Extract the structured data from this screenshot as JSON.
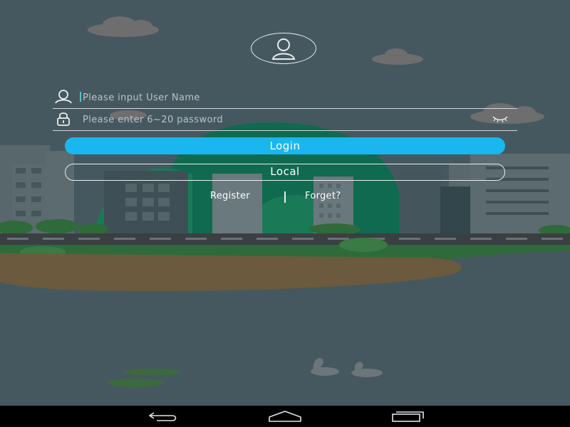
{
  "login_form": {
    "username_placeholder": "Please input User Name",
    "password_placeholder": "Please enter 6~20 password",
    "login_label": "Login",
    "local_label": "Local",
    "register_label": "Register",
    "forget_label": "Forget?"
  },
  "icons": {
    "avatar": "user-avatar-icon",
    "username": "user-icon",
    "password": "lock-icon",
    "toggle_password": "eye-closed-icon",
    "nav_back": "back-icon",
    "nav_home": "home-icon",
    "nav_recent": "recent-apps-icon"
  },
  "colors": {
    "background": "#46585f",
    "accent": "#1ab6ef",
    "navbar": "#000000"
  }
}
